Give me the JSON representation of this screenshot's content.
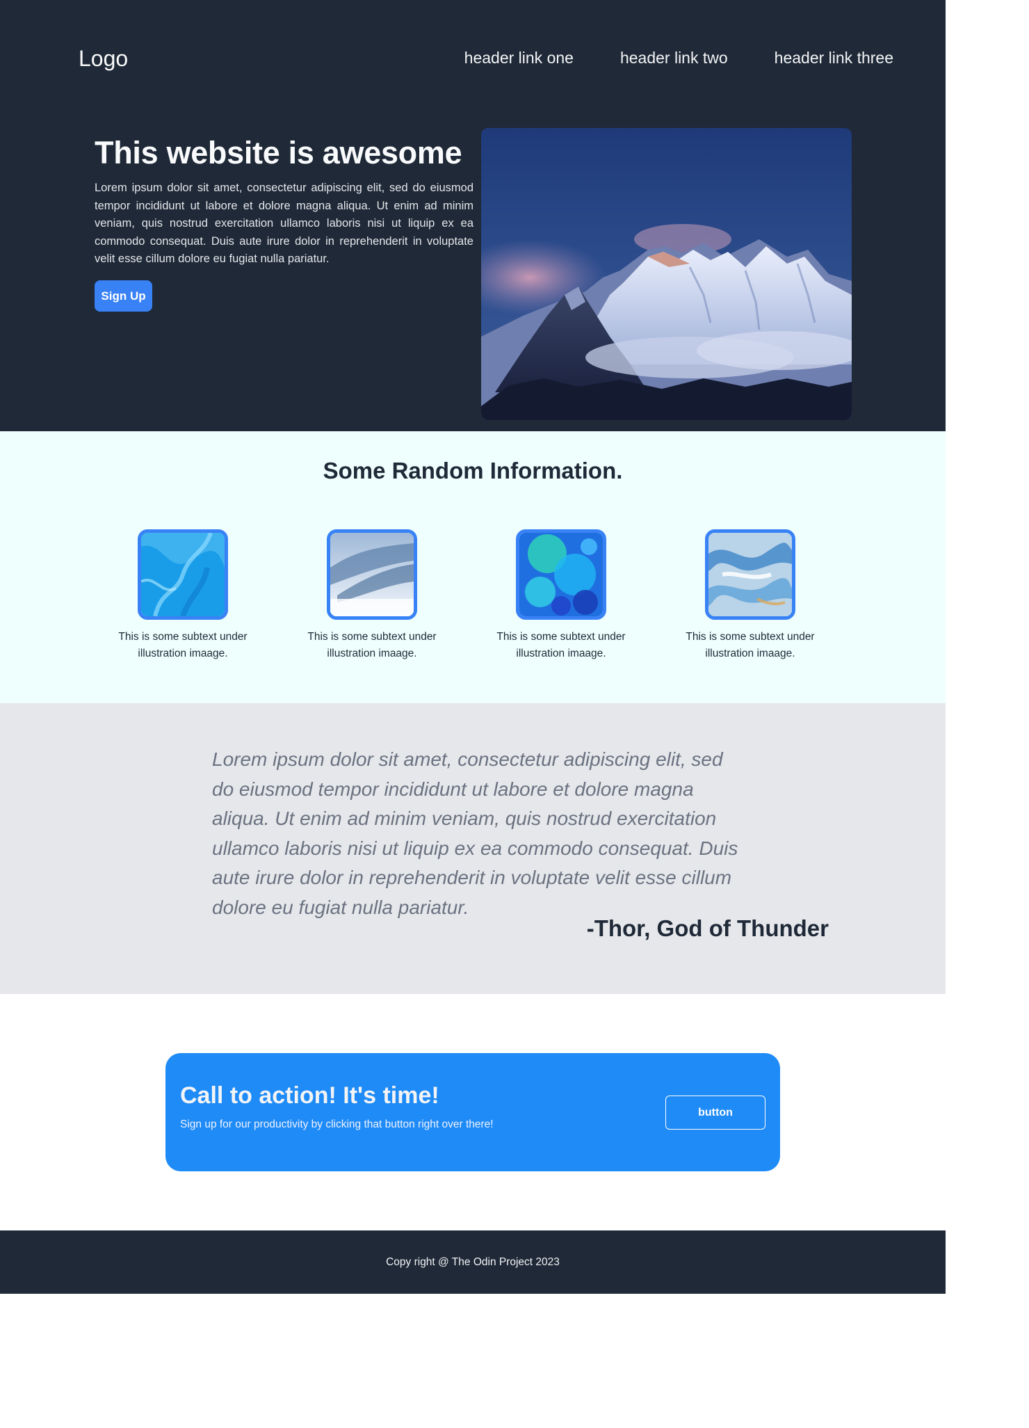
{
  "header": {
    "logo": "Logo",
    "links": [
      "header link one",
      "header link two",
      "header link three"
    ]
  },
  "hero": {
    "title": "This website is awesome",
    "text": "Lorem ipsum dolor sit amet, consectetur adipiscing elit, sed do eiusmod tempor incididunt ut labore et dolore magna aliqua. Ut enim ad minim veniam, quis nostrud exercitation ullamco laboris nisi ut liquip ex ea commodo consequat. Duis aute irure dolor in reprehenderit in voluptate velit esse cillum dolore eu fugiat nulla pariatur.",
    "signup_label": "Sign Up"
  },
  "info": {
    "title": "Some Random Information.",
    "cards": [
      {
        "subtext": "This is some subtext under illustration imaage."
      },
      {
        "subtext": "This is some subtext under illustration imaage."
      },
      {
        "subtext": "This is some subtext under illustration imaage."
      },
      {
        "subtext": "This is some subtext under illustration imaage."
      }
    ]
  },
  "quote": {
    "text": "Lorem ipsum dolor sit amet, consectetur adipiscing elit, sed do eiusmod tempor incididunt ut labore et dolore magna aliqua. Ut enim ad minim veniam, quis nostrud exercitation ullamco laboris nisi ut liquip ex ea commodo consequat. Duis aute irure dolor in reprehenderit in voluptate velit esse cillum dolore eu fugiat nulla pariatur.",
    "author": "-Thor, God of Thunder"
  },
  "cta": {
    "title": "Call to action! It's time!",
    "subtitle": "Sign up for our productivity by clicking that button right over there!",
    "button_label": "button"
  },
  "footer": {
    "text": "Copy right @ The Odin Project 2023"
  },
  "colors": {
    "dark": "#1f2937",
    "accent": "#3882f6",
    "info_bg": "#effffe",
    "quote_bg": "#e5e7eb"
  }
}
